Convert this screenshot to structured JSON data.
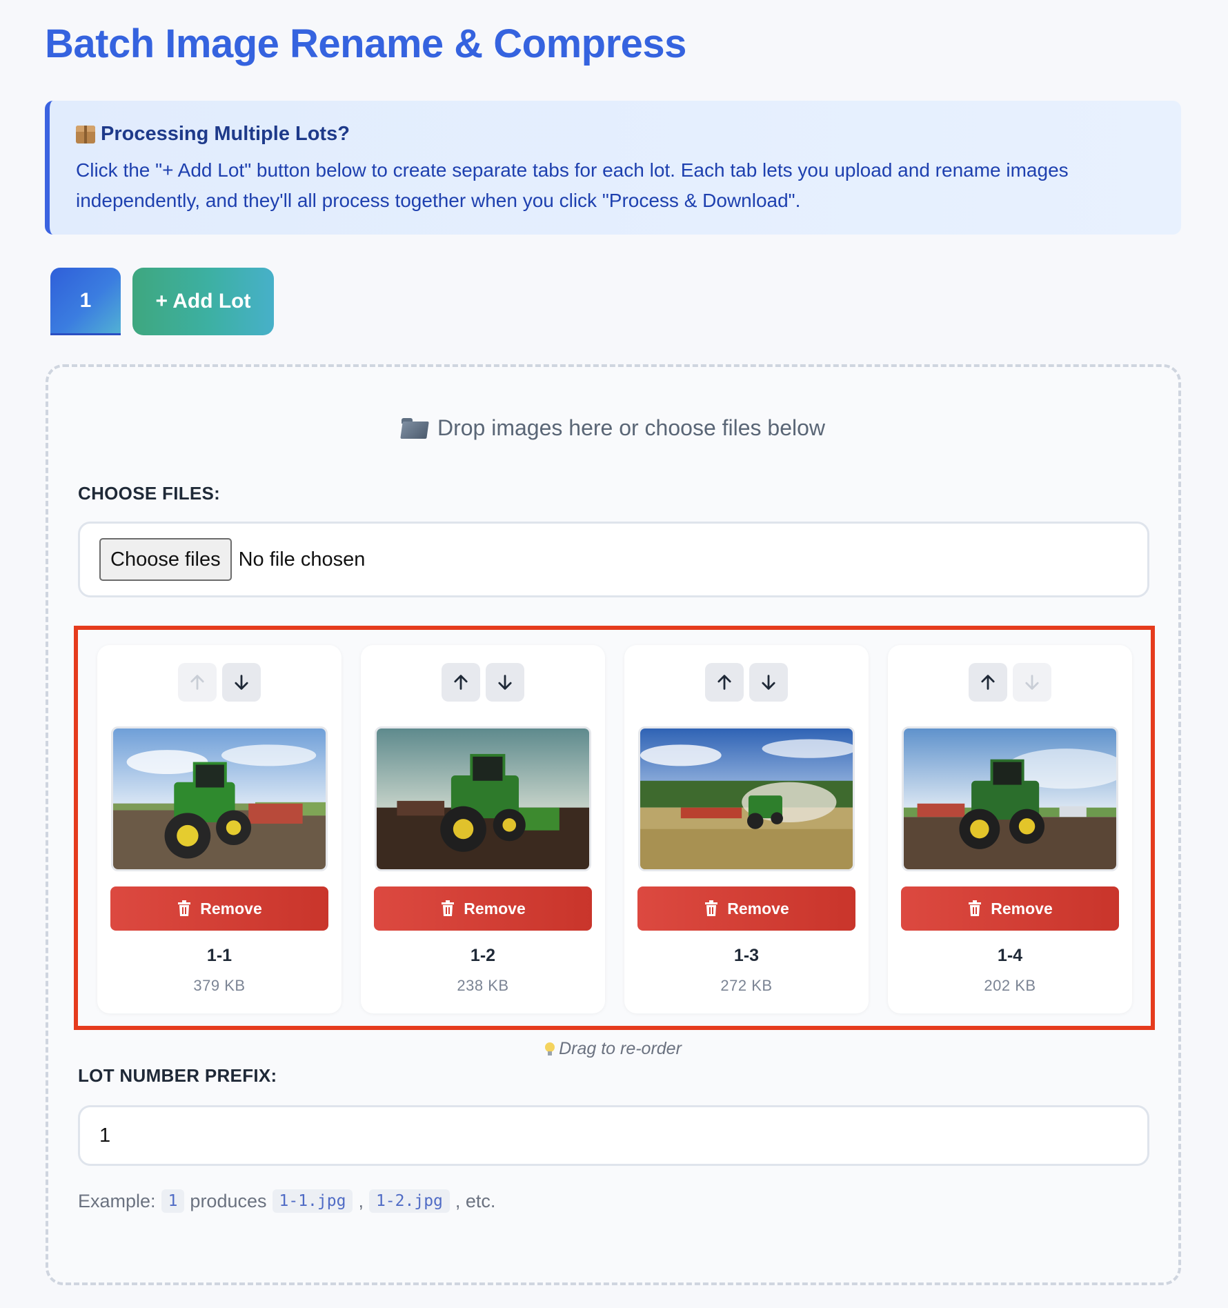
{
  "title": "Batch Image Rename & Compress",
  "info": {
    "heading": "Processing Multiple Lots?",
    "body": "Click the \"+ Add Lot\" button below to create separate tabs for each lot. Each tab lets you upload and rename images independently, and they'll all process together when you click \"Process & Download\".",
    "icon": "package-icon"
  },
  "tabs": {
    "active_label": "1",
    "add_label": "+ Add Lot"
  },
  "upload": {
    "drop_hint": "Drop images here or choose files below",
    "choose_files_label": "CHOOSE FILES:",
    "choose_button": "Choose files",
    "no_file_text": "No file chosen"
  },
  "images": [
    {
      "name": "1-1",
      "size": "379 KB",
      "remove_label": "Remove",
      "up_enabled": false,
      "down_enabled": true,
      "thumb": "green tractor with red harrow on field, blue sky"
    },
    {
      "name": "1-2",
      "size": "238 KB",
      "remove_label": "Remove",
      "up_enabled": true,
      "down_enabled": true,
      "thumb": "green tractor at dusk on dark soil"
    },
    {
      "name": "1-3",
      "size": "272 KB",
      "remove_label": "Remove",
      "up_enabled": true,
      "down_enabled": true,
      "thumb": "tractor with seeder in dusty field"
    },
    {
      "name": "1-4",
      "size": "202 KB",
      "remove_label": "Remove",
      "up_enabled": true,
      "down_enabled": false,
      "thumb": "green tractor on plowed soil"
    }
  ],
  "drag_tip": "Drag to re-order",
  "prefix": {
    "label": "LOT NUMBER PREFIX:",
    "value": "1"
  },
  "example": {
    "lead": "Example:",
    "code1": "1",
    "mid": "produces",
    "code2": "1-1.jpg",
    "sep": ",",
    "code3": "1-2.jpg",
    "tail": ", etc."
  },
  "colors": {
    "title": "#3563df",
    "accent": "#3b63e0",
    "remove": "#d63f35",
    "highlight_frame": "#e53b1d"
  }
}
